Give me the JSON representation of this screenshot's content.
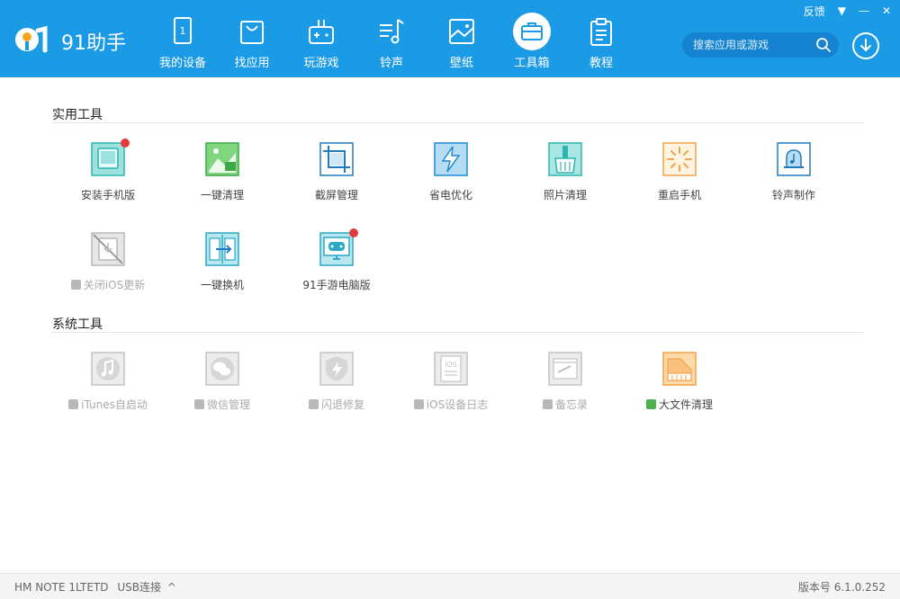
{
  "app": {
    "name": "91助手"
  },
  "window": {
    "feedback": "反馈",
    "menu_icon": "dropdown-icon",
    "minimize": "—",
    "close": "✕"
  },
  "nav": [
    {
      "label": "我的设备",
      "icon": "device-icon"
    },
    {
      "label": "找应用",
      "icon": "shopping-bag-icon"
    },
    {
      "label": "玩游戏",
      "icon": "gamepad-icon"
    },
    {
      "label": "铃声",
      "icon": "music-note-icon"
    },
    {
      "label": "壁纸",
      "icon": "image-icon"
    },
    {
      "label": "工具箱",
      "icon": "toolbox-icon",
      "active": true
    },
    {
      "label": "教程",
      "icon": "clipboard-icon"
    }
  ],
  "search": {
    "placeholder": "搜索应用或游戏"
  },
  "sections": {
    "utility": {
      "title": "实用工具"
    },
    "system": {
      "title": "系统工具"
    }
  },
  "utility_tools": [
    {
      "label": "安装手机版",
      "icon": "tablet-icon",
      "badge": true
    },
    {
      "label": "一键清理",
      "icon": "clean-image-icon"
    },
    {
      "label": "截屏管理",
      "icon": "crop-icon"
    },
    {
      "label": "省电优化",
      "icon": "lightning-icon"
    },
    {
      "label": "照片清理",
      "icon": "broom-icon"
    },
    {
      "label": "重启手机",
      "icon": "restart-burst-icon"
    },
    {
      "label": "铃声制作",
      "icon": "bell-icon"
    },
    {
      "label": "关闭iOS更新",
      "icon": "update-off-icon",
      "disabled": true,
      "prefix": "apple-icon"
    },
    {
      "label": "一键换机",
      "icon": "phone-transfer-icon"
    },
    {
      "label": "91手游电脑版",
      "icon": "game-monitor-icon",
      "badge": true
    }
  ],
  "system_tools": [
    {
      "label": "iTunes自启动",
      "icon": "itunes-icon",
      "disabled": true,
      "prefix": "apple-icon"
    },
    {
      "label": "微信管理",
      "icon": "wechat-icon",
      "disabled": true,
      "prefix": "apple-icon"
    },
    {
      "label": "闪退修复",
      "icon": "shield-lightning-icon",
      "disabled": true,
      "prefix": "apple-icon"
    },
    {
      "label": "iOS设备日志",
      "icon": "log-icon",
      "disabled": true,
      "prefix": "apple-icon"
    },
    {
      "label": "备忘录",
      "icon": "memo-icon",
      "disabled": true,
      "prefix": "apple-icon"
    },
    {
      "label": "大文件清理",
      "icon": "large-file-icon",
      "prefix": "android-icon"
    }
  ],
  "footer": {
    "device": "HM NOTE 1LTETD",
    "connection": "USB连接",
    "version": "版本号 6.1.0.252"
  },
  "colors": {
    "header": "#1b9ae6",
    "badge": "#e03b3b",
    "teal": "#2ab5b0",
    "orange": "#f2a24a",
    "disabled": "#b8b8b8",
    "android": "#4caf50"
  }
}
